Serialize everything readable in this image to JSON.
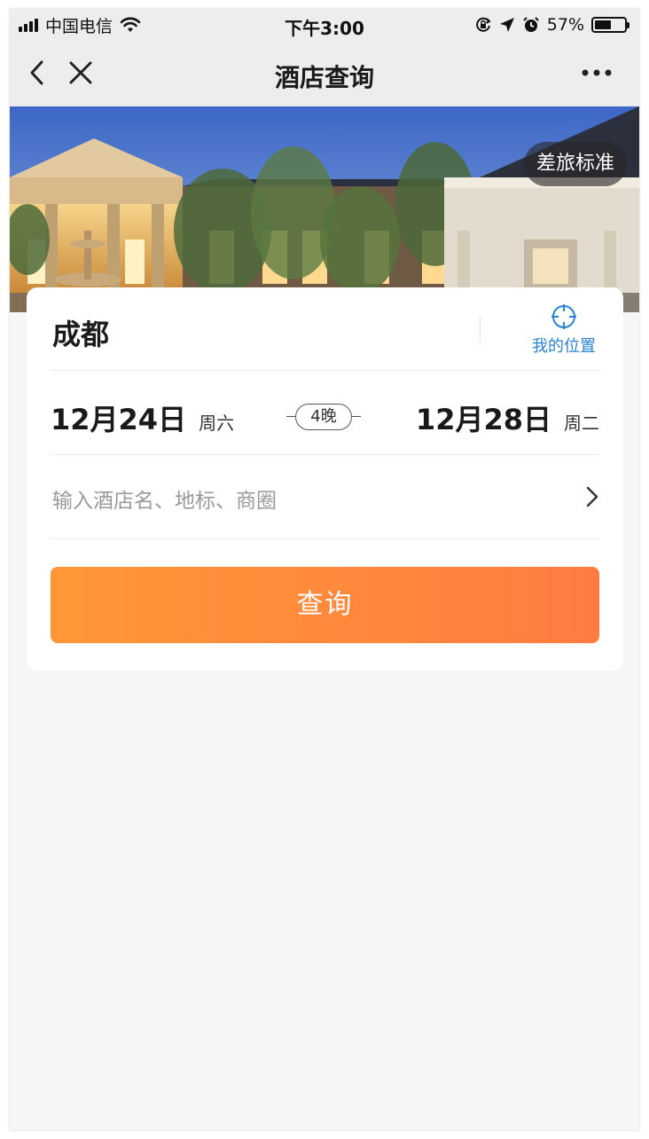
{
  "status_bar": {
    "carrier": "中国电信",
    "time": "下午3:00",
    "battery_percent_text": "57%",
    "battery_level": 0.57,
    "icons": [
      "signal-icon",
      "wifi-icon",
      "rotation-lock-icon",
      "location-arrow-icon",
      "alarm-icon",
      "battery-icon"
    ]
  },
  "nav": {
    "title": "酒店查询",
    "back_icon": "chevron-left-icon",
    "close_icon": "close-icon",
    "more_icon": "more-icon"
  },
  "banner": {
    "policy_tag": "差旅标准"
  },
  "search_card": {
    "city": "成都",
    "location_label": "我的位置",
    "check_in": {
      "date": "12月24日",
      "weekday": "周六"
    },
    "nights": "4晚",
    "check_out": {
      "date": "12月28日",
      "weekday": "周二"
    },
    "search_placeholder": "输入酒店名、地标、商圈",
    "query_button": "查询"
  },
  "colors": {
    "accent_orange_start": "#ff9737",
    "accent_orange_end": "#ff7c40",
    "link_blue": "#2b83d8",
    "background": "#f6f6f6",
    "nav_background": "#ededed"
  }
}
